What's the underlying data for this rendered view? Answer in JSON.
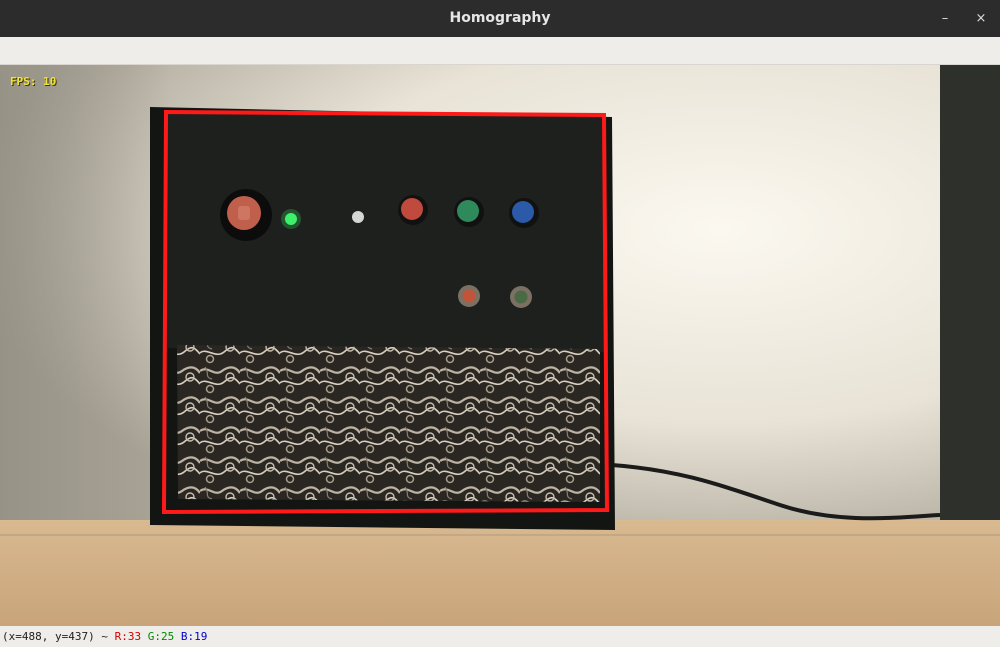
{
  "window": {
    "title": "Homography",
    "minimize_glyph": "–",
    "close_glyph": "×"
  },
  "overlay": {
    "fps_text": "FPS: 10"
  },
  "status": {
    "coords": "(x=488, y=437) ~ ",
    "r": "R:33",
    "g": "G:25",
    "b": "B:19",
    "r_color": "#d00000",
    "g_color": "#008800",
    "b_color": "#0000cc"
  },
  "colors": {
    "highlight_border": "#ff1a1a",
    "panel": "#1b1d1b"
  }
}
